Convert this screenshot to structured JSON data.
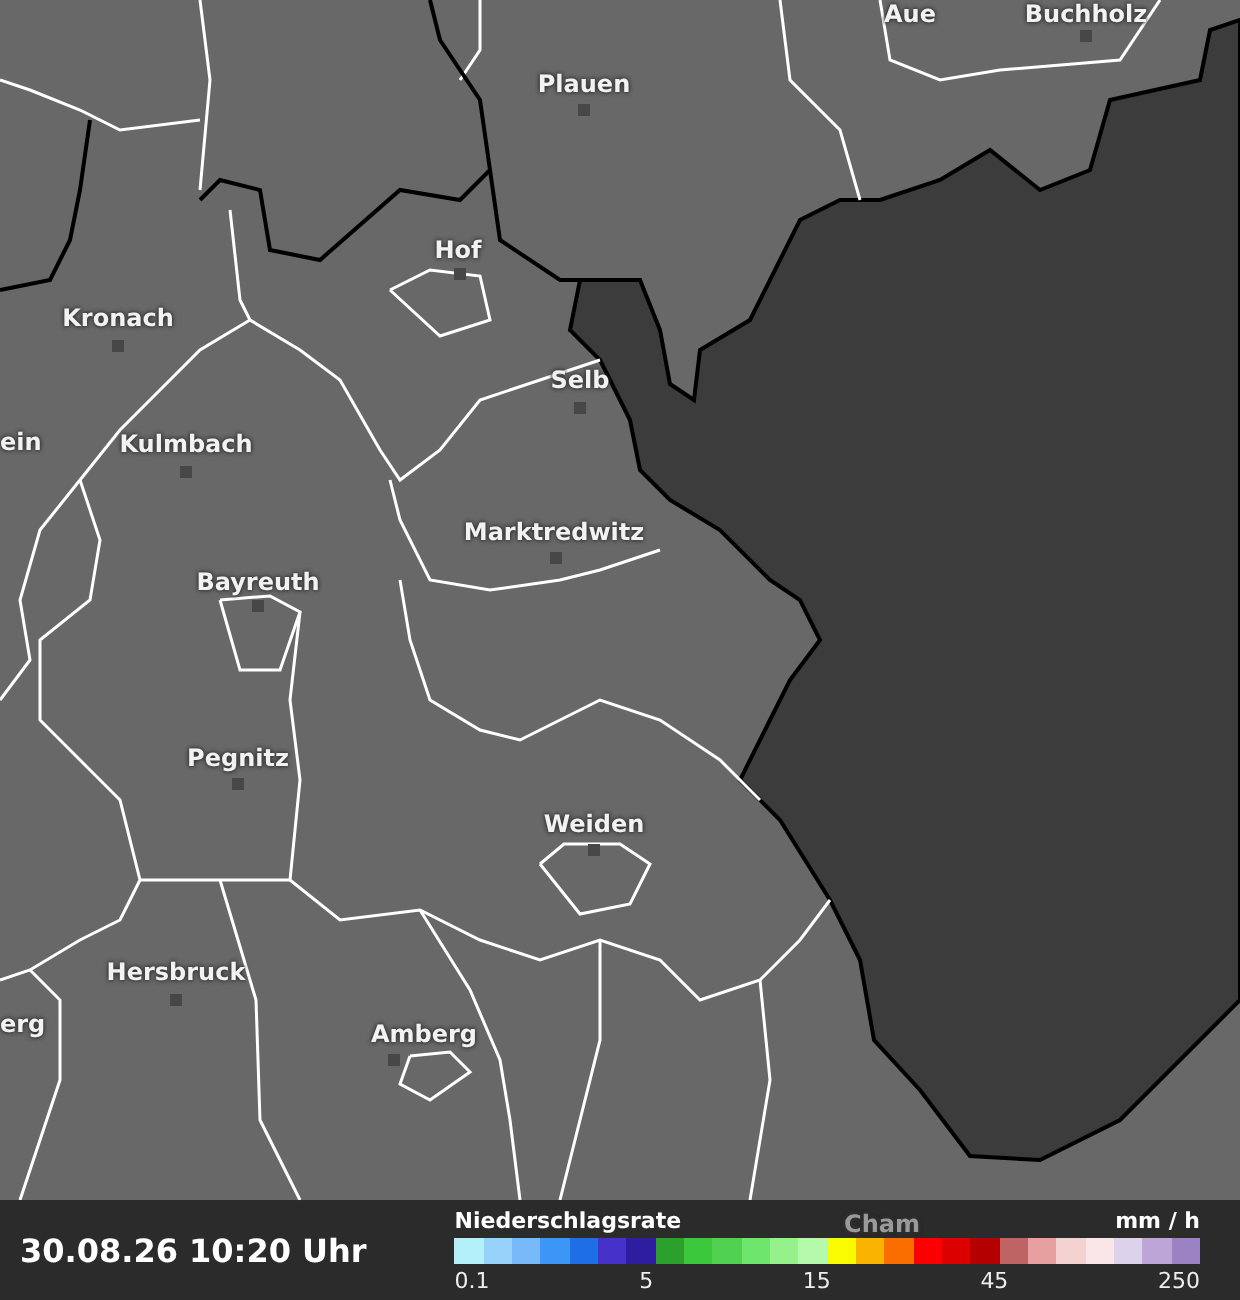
{
  "map": {
    "places": [
      {
        "name": "Aue"
      },
      {
        "name": "Buchholz"
      },
      {
        "name": "Plauen"
      },
      {
        "name": "Hof"
      },
      {
        "name": "Kronach"
      },
      {
        "name": "Selb"
      },
      {
        "name": "ein"
      },
      {
        "name": "Kulmbach"
      },
      {
        "name": "Marktredwitz"
      },
      {
        "name": "Bayreuth"
      },
      {
        "name": "Pegnitz"
      },
      {
        "name": "Weiden"
      },
      {
        "name": "Hersbruck"
      },
      {
        "name": "erg"
      },
      {
        "name": "Amberg"
      },
      {
        "name": "Cham"
      }
    ]
  },
  "status_bar": {
    "timestamp": "30.08.26 10:20 Uhr"
  },
  "legend": {
    "title": "Niederschlagsrate",
    "unit": "mm / h",
    "swatches": [
      {
        "color": "#b4f0fa"
      },
      {
        "color": "#96d2fa"
      },
      {
        "color": "#78b9fa"
      },
      {
        "color": "#3c96f5"
      },
      {
        "color": "#1e6ee6"
      },
      {
        "color": "#4632c8"
      },
      {
        "color": "#2d1ea0"
      },
      {
        "color": "#2ca02c"
      },
      {
        "color": "#3cc83c"
      },
      {
        "color": "#50d250"
      },
      {
        "color": "#6ee66e"
      },
      {
        "color": "#96f08c"
      },
      {
        "color": "#b4faaa"
      },
      {
        "color": "#fafa00"
      },
      {
        "color": "#fab400"
      },
      {
        "color": "#fa6e00"
      },
      {
        "color": "#fa0000"
      },
      {
        "color": "#dc0000"
      },
      {
        "color": "#b40000"
      },
      {
        "color": "#be6464"
      },
      {
        "color": "#e6a0a0"
      },
      {
        "color": "#f5d2d2"
      },
      {
        "color": "#fae6e6"
      },
      {
        "color": "#dcd2eb"
      },
      {
        "color": "#bea5d7"
      },
      {
        "color": "#9b82c3"
      }
    ],
    "ticks": [
      "0.1",
      "5",
      "15",
      "45",
      "250"
    ]
  }
}
